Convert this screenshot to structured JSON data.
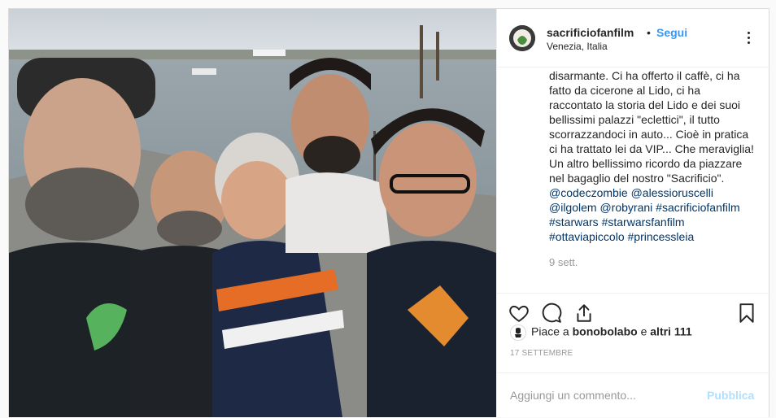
{
  "post": {
    "username": "sacrificiofanfilm",
    "separator": "•",
    "follow_label": "Segui",
    "location": "Venezia, Italia",
    "caption_lines": [
      "disarmante. Ci ha offerto il caffè, ci ha",
      "fatto da cicerone al Lido, ci ha",
      "raccontato la storia del Lido e dei suoi",
      "bellissimi palazzi \"eclettici\", il tutto",
      "scorrazzandoci in auto... Cioè in pratica",
      "ci ha trattato lei da VIP... Che meraviglia!",
      "Un altro bellissimo ricordo da piazzare",
      "nel bagaglio del nostro \"Sacrificio\"."
    ],
    "tags": {
      "t1": "@codeczombie",
      "t2": "@alessioruscelli",
      "t3": "@ilgolem",
      "t4": "@robyrani",
      "t5": "#sacrificiofanfilm",
      "t6": "#starwars",
      "t7": "#starwarsfanfilm",
      "t8": "#ottaviapiccolo",
      "t9": "#princessleia"
    },
    "time_ago": "9 sett.",
    "likes": {
      "prefix": "Piace a",
      "user": "bonobolabo",
      "joiner": "e",
      "others": "altri 111"
    },
    "date": "17 SETTEMBRE",
    "comment_placeholder": "Aggiungi un commento...",
    "publish_label": "Pubblica"
  },
  "icons": [
    "more-options-icon",
    "heart-icon",
    "comment-icon",
    "share-icon",
    "bookmark-icon"
  ],
  "colors": {
    "link": "#3897f0",
    "hashtag": "#003569",
    "muted": "#999999",
    "publish_disabled": "#b2dffc"
  }
}
